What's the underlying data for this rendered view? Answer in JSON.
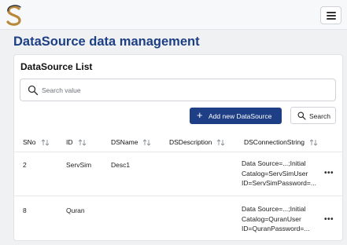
{
  "header": {
    "logo_icon": "s-logo-icon",
    "menu_icon": "hamburger-menu-icon"
  },
  "page": {
    "title": "DataSource data management"
  },
  "card": {
    "title": "DataSource List"
  },
  "search": {
    "placeholder": "Search value",
    "value": "",
    "icon": "search-icon"
  },
  "toolbar": {
    "add_label": "Add new DataSource",
    "add_icon": "plus-icon",
    "search_label": "Search",
    "search_icon": "search-icon"
  },
  "colors": {
    "primary": "#1e3f86",
    "title": "#1d3f84",
    "logo_gold": "#b8893a"
  },
  "table": {
    "columns": [
      {
        "label": "SNo"
      },
      {
        "label": "ID"
      },
      {
        "label": "DSName"
      },
      {
        "label": "DSDescription"
      },
      {
        "label": "DSConnectionString"
      }
    ],
    "rows": [
      {
        "sno": "2",
        "id": "ServSim",
        "name": "Desc1",
        "description": "",
        "conn1": "Data Source=...;Initial",
        "conn2": "Catalog=ServSimUser",
        "conn3": "ID=ServSimPassword=...",
        "actions": "•••"
      },
      {
        "sno": "8",
        "id": "Quran",
        "name": "",
        "description": "",
        "conn1": "Data Source=...;Initial",
        "conn2": "Catalog=QuranUser",
        "conn3": "ID=QuranPassword=...",
        "actions": "•••"
      }
    ]
  }
}
